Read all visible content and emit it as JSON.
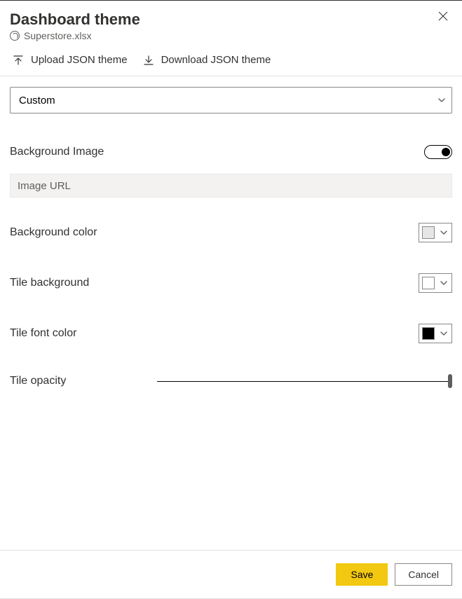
{
  "header": {
    "title": "Dashboard theme",
    "subtitle": "Superstore.xlsx"
  },
  "toolbar": {
    "upload_label": "Upload JSON theme",
    "download_label": "Download JSON theme"
  },
  "theme_select": {
    "value": "Custom"
  },
  "fields": {
    "background_image_label": "Background Image",
    "image_url_placeholder": "Image URL",
    "background_color_label": "Background color",
    "background_color_value": "#e6e6e6",
    "tile_background_label": "Tile background",
    "tile_background_value": "#ffffff",
    "tile_font_color_label": "Tile font color",
    "tile_font_color_value": "#000000",
    "tile_opacity_label": "Tile opacity",
    "tile_opacity_value": 100
  },
  "footer": {
    "save_label": "Save",
    "cancel_label": "Cancel"
  }
}
